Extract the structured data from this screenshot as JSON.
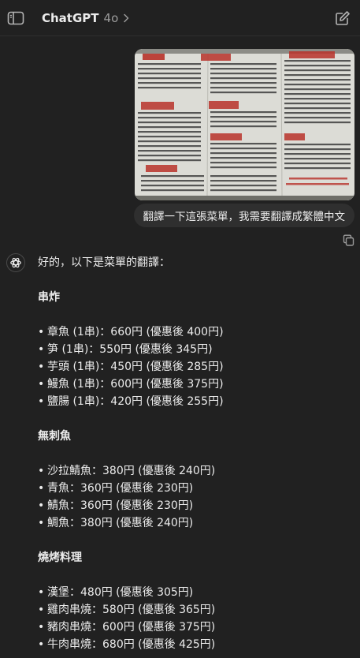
{
  "header": {
    "title": "ChatGPT",
    "model": "4o",
    "icons": {
      "left": "sidebar-icon",
      "chevron": "chevron-right-icon",
      "right": "new-chat-icon"
    }
  },
  "user_message": {
    "text": "翻譯一下這張菜單，我需要翻譯成繁體中文",
    "image_icon": "menu-photo"
  },
  "assistant": {
    "intro": "好的，以下是菜單的翻譯：",
    "sections": [
      {
        "title": "串炸",
        "items": [
          "章魚 (1串)：660円 (優惠後 400円)",
          "笋 (1串)：550円 (優惠後 345円)",
          "芋頭 (1串)：450円 (優惠後 285円)",
          "鰻魚 (1串)：600円 (優惠後 375円)",
          "鹽腸 (1串)：420円 (優惠後 255円)"
        ]
      },
      {
        "title": "無刺魚",
        "items": [
          "沙拉鯖魚：380円 (優惠後 240円)",
          "青魚：360円 (優惠後 230円)",
          "鯖魚：360円 (優惠後 230円)",
          "鯛魚：380円 (優惠後 240円)"
        ]
      },
      {
        "title": "燒烤料理",
        "items": [
          "漢堡：480円 (優惠後 305円)",
          "雞肉串燒：580円 (優惠後 365円)",
          "豬肉串燒：600円 (優惠後 375円)",
          "牛肉串燒：680円 (優惠後 425円)"
        ]
      }
    ]
  },
  "colors": {
    "background": "#212121",
    "bubble": "#2f2f2f",
    "text": "#ececec",
    "muted": "#9b9b9b",
    "menu_heading_red": "#b8322a"
  }
}
